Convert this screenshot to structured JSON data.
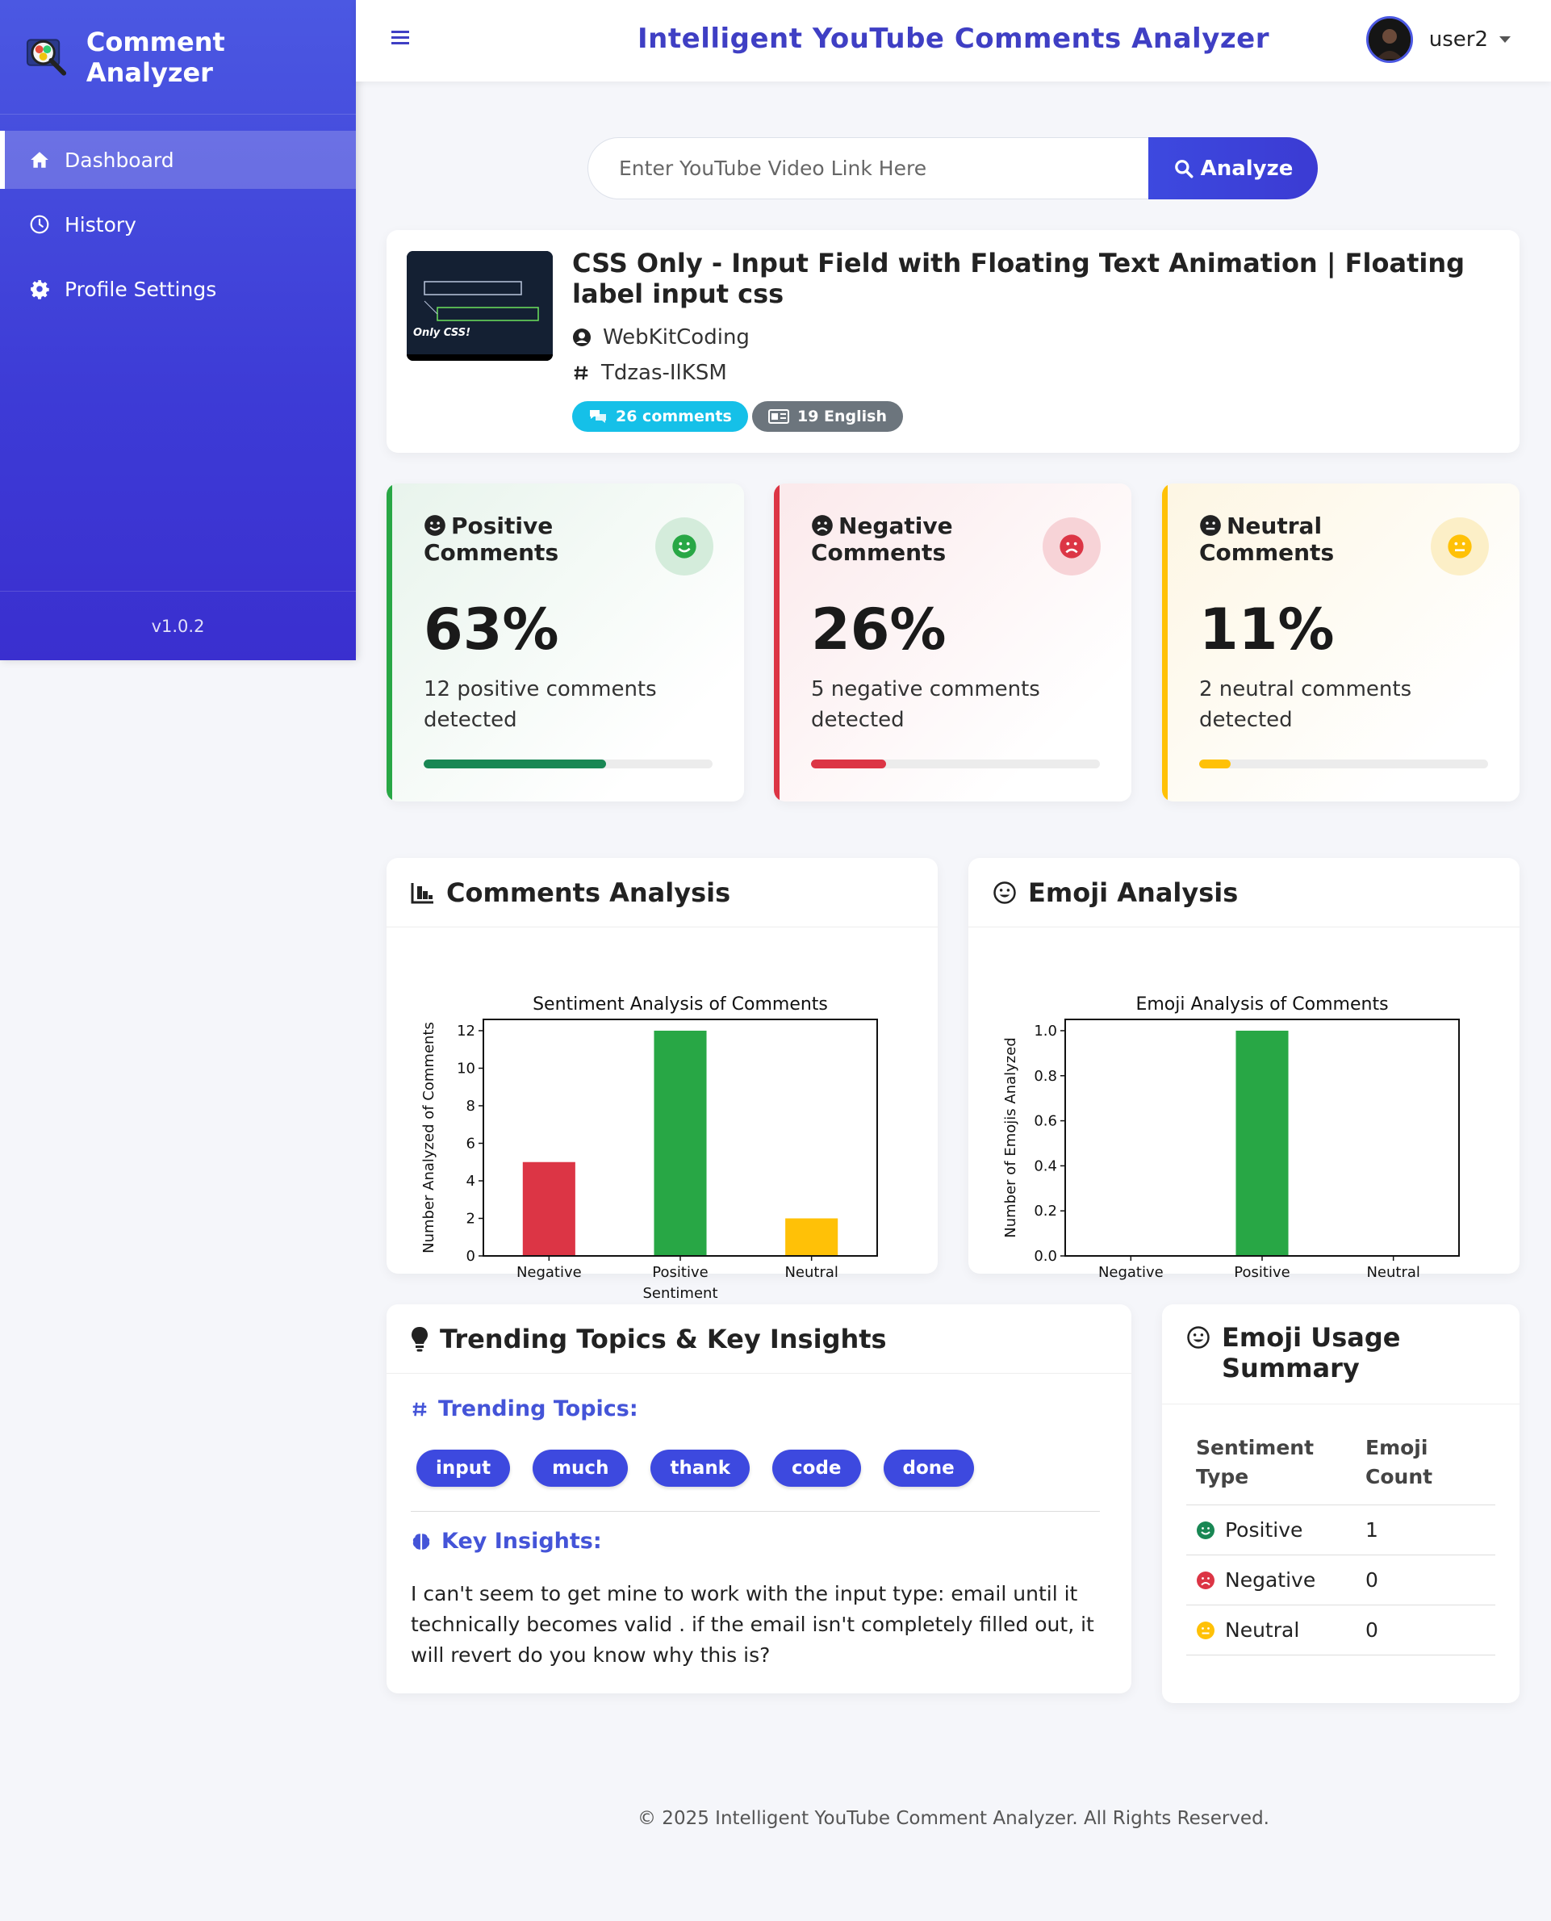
{
  "sidebar": {
    "brand": "Comment Analyzer",
    "items": [
      {
        "label": "Dashboard",
        "icon": "home-icon",
        "active": true
      },
      {
        "label": "History",
        "icon": "clock-icon",
        "active": false
      },
      {
        "label": "Profile Settings",
        "icon": "gear-icon",
        "active": false
      }
    ],
    "version": "v1.0.2"
  },
  "header": {
    "title": "Intelligent YouTube Comments Analyzer",
    "username": "user2"
  },
  "search": {
    "placeholder": "Enter YouTube Video Link Here",
    "button_label": "Analyze"
  },
  "video": {
    "title": "CSS Only - Input Field with Floating Text Animation | Floating label input css",
    "channel": "WebKitCoding",
    "video_id": "Tdzas-IlKSM",
    "comments_badge": "26 comments",
    "language_badge": "19 English",
    "thumbnail_text": "Only CSS!"
  },
  "stats": [
    {
      "key": "positive",
      "title_line1": "Positive",
      "title_line2": "Comments",
      "percent_label": "63%",
      "percent": 63,
      "description": "12 positive comments detected",
      "color": "#198754"
    },
    {
      "key": "negative",
      "title_line1": "Negative",
      "title_line2": "Comments",
      "percent_label": "26%",
      "percent": 26,
      "description": "5 negative comments detected",
      "color": "#dc3545"
    },
    {
      "key": "neutral",
      "title_line1": "Neutral",
      "title_line2": "Comments",
      "percent_label": "11%",
      "percent": 11,
      "description": "2 neutral comments detected",
      "color": "#ffc107"
    }
  ],
  "comments_panel": {
    "heading": "Comments Analysis"
  },
  "emoji_panel": {
    "heading": "Emoji Analysis"
  },
  "chart_data": [
    {
      "type": "bar",
      "title": "Sentiment Analysis of Comments",
      "xlabel": "Sentiment",
      "ylabel": "Number Analyzed of Comments",
      "categories": [
        "Negative",
        "Positive",
        "Neutral"
      ],
      "values": [
        5,
        12,
        2
      ],
      "colors": [
        "#dc3545",
        "#28a745",
        "#ffc107"
      ],
      "ylim": [
        0,
        12.6
      ],
      "yticks": [
        "0",
        "2",
        "4",
        "6",
        "8",
        "10",
        "12"
      ],
      "ytick_values": [
        0,
        2,
        4,
        6,
        8,
        10,
        12
      ]
    },
    {
      "type": "bar",
      "title": "Emoji Analysis of Comments",
      "xlabel": "",
      "ylabel": "Number of Emojis Analyzed",
      "categories": [
        "Negative",
        "Positive",
        "Neutral"
      ],
      "values": [
        0,
        1,
        0
      ],
      "colors": [
        "#dc3545",
        "#28a745",
        "#ffc107"
      ],
      "ylim": [
        0,
        1.05
      ],
      "yticks": [
        "0.0",
        "0.2",
        "0.4",
        "0.6",
        "0.8",
        "1.0"
      ],
      "ytick_values": [
        0,
        0.2,
        0.4,
        0.6,
        0.8,
        1.0
      ]
    }
  ],
  "trending": {
    "heading": "Trending Topics & Key Insights",
    "topics_label": "Trending Topics:",
    "topics": [
      "input",
      "much",
      "thank",
      "code",
      "done"
    ],
    "insights_label": "Key Insights:",
    "insight": "I can't seem to get mine to work with the input type: email until it technically becomes valid . if the email isn't completely filled out, it will revert do you know why this is?"
  },
  "emoji_summary": {
    "heading": "Emoji Usage Summary",
    "col_type": "Sentiment Type",
    "col_count": "Emoji Count",
    "rows": [
      {
        "type": "Positive",
        "count": "1",
        "color": "#198754"
      },
      {
        "type": "Negative",
        "count": "0",
        "color": "#dc3545"
      },
      {
        "type": "Neutral",
        "count": "0",
        "color": "#ffc107"
      }
    ]
  },
  "footer": "© 2025 Intelligent YouTube Comment Analyzer. All Rights Reserved."
}
